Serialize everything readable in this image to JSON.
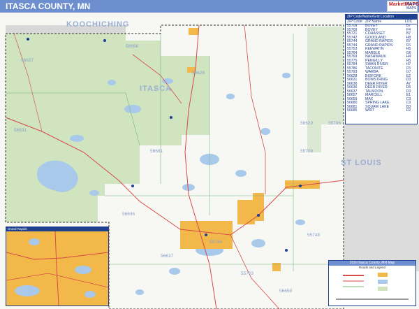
{
  "title": "ITASCA COUNTY, MN",
  "brand": {
    "logo_text": "MarketMAPS",
    "side_text": "Market MAPS"
  },
  "colors": {
    "title_bar": "#6d8fd0",
    "forest": "#cfe4bf",
    "water": "#a9c9ea",
    "urban": "#f2b84a",
    "road": "#d64a4a",
    "zip_boundary": "#78b878",
    "legend_border": "#1f3f8f"
  },
  "map": {
    "regions": {
      "koochiching": "KOOCHICHING",
      "itasca": "ITASCA",
      "st_louis": "ST LOUIS"
    },
    "zip_labels": [
      "56688",
      "56627",
      "56628",
      "56629",
      "56631",
      "56681",
      "55709",
      "56636",
      "55744",
      "56637",
      "55786",
      "55748",
      "55703",
      "56659"
    ],
    "icons": [
      "north-arrow-icon",
      "city-dot-icon"
    ]
  },
  "legend": {
    "header": "ZIP Code/Name/Grid Location",
    "columns": {
      "zip": "ZIP Code",
      "name": "ZIP Name",
      "loc": "LOC"
    },
    "rows": [
      {
        "zip": "55709",
        "name": "BOVEY",
        "loc": "B7"
      },
      {
        "zip": "55709",
        "name": "BOVEY",
        "loc": "F4"
      },
      {
        "zip": "55721",
        "name": "COHASSET",
        "loc": "B7"
      },
      {
        "zip": "55742",
        "name": "GOODLAND",
        "loc": "H8"
      },
      {
        "zip": "55744",
        "name": "GRAND RAPIDS",
        "loc": "B7"
      },
      {
        "zip": "55744",
        "name": "GRAND RAPIDS",
        "loc": "F6"
      },
      {
        "zip": "55753",
        "name": "KEEWATIN",
        "loc": "H5"
      },
      {
        "zip": "55764",
        "name": "MARBLE",
        "loc": "G6"
      },
      {
        "zip": "55769",
        "name": "NASHWAUK",
        "loc": "H4"
      },
      {
        "zip": "55775",
        "name": "PENGILLY",
        "loc": "H5"
      },
      {
        "zip": "55784",
        "name": "SWAN RIVER",
        "loc": "H7"
      },
      {
        "zip": "55786",
        "name": "TACONITE",
        "loc": "F5"
      },
      {
        "zip": "55793",
        "name": "WARBA",
        "loc": "G7"
      },
      {
        "zip": "56628",
        "name": "BIGFORK",
        "loc": "E2"
      },
      {
        "zip": "56631",
        "name": "BOWSTRING",
        "loc": "D3"
      },
      {
        "zip": "56636",
        "name": "DEER RIVER",
        "loc": "A7"
      },
      {
        "zip": "56636",
        "name": "DEER RIVER",
        "loc": "D6"
      },
      {
        "zip": "56637",
        "name": "TALMOON",
        "loc": "D3"
      },
      {
        "zip": "56657",
        "name": "MARCELL",
        "loc": "E1"
      },
      {
        "zip": "56659",
        "name": "MAX",
        "loc": "C3"
      },
      {
        "zip": "56680",
        "name": "SPRING LAKE",
        "loc": "C3"
      },
      {
        "zip": "56681",
        "name": "SQUAW LAKE",
        "loc": "B3"
      },
      {
        "zip": "56685",
        "name": "WIRT",
        "loc": "D2"
      }
    ]
  },
  "inset": {
    "header": "Grand Rapids"
  },
  "infobox": {
    "title": "2016 Itasca County, MN Map",
    "subtitle": "Roads and Legend"
  }
}
